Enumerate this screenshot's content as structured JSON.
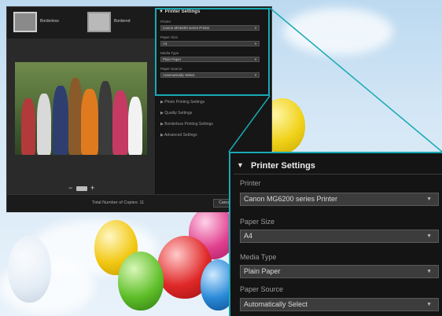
{
  "layouts": [
    {
      "label": "Borderless",
      "selected": true
    },
    {
      "label": "Bordered",
      "selected": false
    }
  ],
  "preview": {
    "zoom_minus": "−",
    "zoom_plus": "+"
  },
  "side_panel": {
    "title": "Printer Settings",
    "printer_label": "Printer",
    "printer_value": "Canon MG6200 series Printer",
    "paper_size_label": "Paper Size",
    "paper_size_value": "A4",
    "media_type_label": "Media Type",
    "media_type_value": "Plain Paper",
    "paper_source_label": "Paper Source",
    "paper_source_value": "Automatically Select",
    "sections": [
      "Photo Printing Settings",
      "Quality Settings",
      "Borderless Printing Settings",
      "Advanced Settings"
    ]
  },
  "footer": {
    "total_label": "Total Number of Copies: 11",
    "cancel_label": "Cancel"
  },
  "zoom_panel": {
    "title": "Printer Settings",
    "printer_label": "Printer",
    "printer_value": "Canon MG6200 series Printer",
    "paper_size_label": "Paper Size",
    "paper_size_value": "A4",
    "media_type_label": "Media Type",
    "media_type_value": "Plain Paper",
    "paper_source_label": "Paper Source",
    "paper_source_value": "Automatically Select"
  },
  "colors": {
    "highlight": "#18a9b4",
    "panel_bg": "#141414",
    "select_bg": "#3c3c3c"
  },
  "icons": {
    "collapse": "triangle-down-icon",
    "dropdown": "dropdown-arrow-icon"
  }
}
